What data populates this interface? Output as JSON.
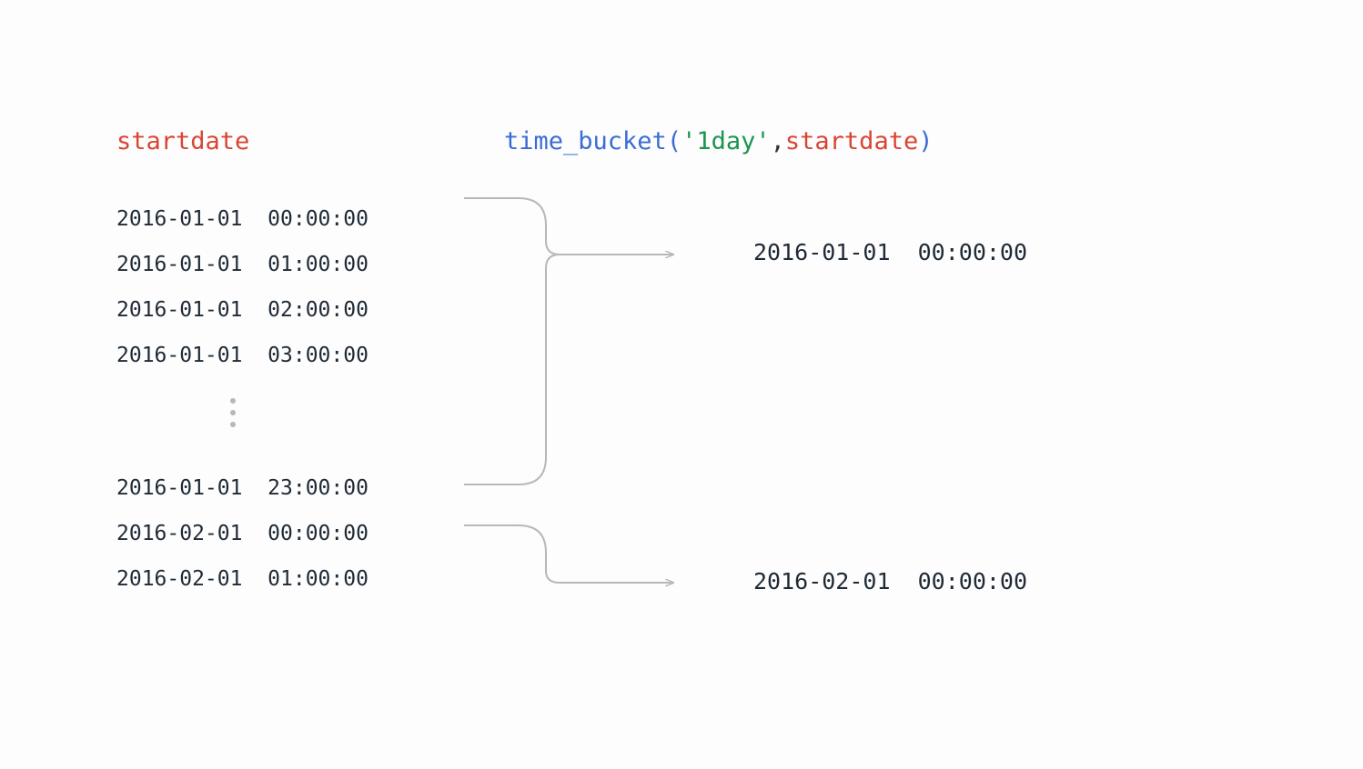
{
  "left_header": "startdate",
  "right_header": {
    "func": "time_bucket",
    "open": "(",
    "quote1": "'",
    "str": "1day",
    "quote2": "'",
    "comma": ",",
    "arg": "startdate",
    "close": ")"
  },
  "left_rows_top": [
    "2016-01-01  00:00:00",
    "2016-01-01  01:00:00",
    "2016-01-01  02:00:00",
    "2016-01-01  03:00:00"
  ],
  "left_rows_bottom": [
    "2016-01-01  23:00:00",
    "2016-02-01  00:00:00",
    "2016-02-01  01:00:00"
  ],
  "right_results": [
    "2016-01-01  00:00:00",
    "2016-02-01  00:00:00"
  ]
}
